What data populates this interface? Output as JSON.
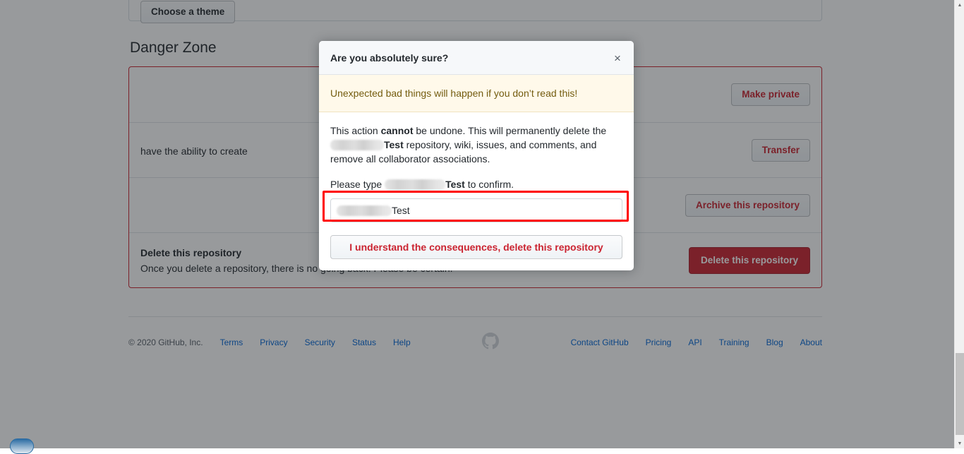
{
  "page": {
    "theme_button_label": "Choose a theme",
    "danger_zone_title": "Danger Zone",
    "rows": [
      {
        "title": "",
        "desc": "",
        "button": "Make private"
      },
      {
        "title": "",
        "desc": "have the ability to create",
        "button": "Transfer"
      },
      {
        "title": "",
        "desc": "",
        "button": "Archive this repository"
      },
      {
        "title": "Delete this repository",
        "desc": "Once you delete a repository, there is no going back. Please be certain.",
        "button": "Delete this repository"
      }
    ]
  },
  "footer": {
    "copyright": "© 2020 GitHub, Inc.",
    "left_links": [
      "Terms",
      "Privacy",
      "Security",
      "Status",
      "Help"
    ],
    "right_links": [
      "Contact GitHub",
      "Pricing",
      "API",
      "Training",
      "Blog",
      "About"
    ],
    "logo": "github-mark-icon"
  },
  "modal": {
    "title": "Are you absolutely sure?",
    "close_icon": "×",
    "warning": "Unexpected bad things will happen if you don’t read this!",
    "body": {
      "line1_a": "This action ",
      "line1_bold": "cannot",
      "line1_b": " be undone. This will permanently delete the ",
      "line1_redacted": "[redacted owner]",
      "line1_repo_bold": "Test",
      "line1_c": " repository, wiki, issues, and comments, and remove all collaborator associations.",
      "line2_a": "Please type ",
      "line2_redacted": "[redacted owner]",
      "line2_repo_bold": "Test",
      "line2_b": " to confirm."
    },
    "input": {
      "value_redacted": "[redacted owner]",
      "value_visible": "Test",
      "placeholder": ""
    },
    "submit_label": "I understand the consequences, delete this repository"
  },
  "colors": {
    "danger_red": "#cb2431",
    "warning_bg": "#fff9ea",
    "warning_text": "#735c0f",
    "link_blue": "#0366d6",
    "annotation_red": "#ff0000",
    "overlay": "rgba(27,31,35,0.45)"
  },
  "scrollbar": {
    "up_arrow": "▲",
    "down_arrow": "▼"
  }
}
